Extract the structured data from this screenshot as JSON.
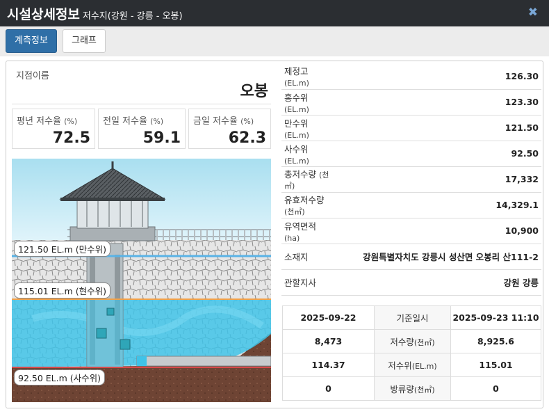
{
  "header": {
    "title": "시설상세정보",
    "subtitle": "저수지(강원 - 강릉 - 오봉)",
    "close_icon": "close-icon"
  },
  "tabs": [
    {
      "label": "계측정보",
      "active": true
    },
    {
      "label": "그래프",
      "active": false
    }
  ],
  "site": {
    "name_label": "지점이름",
    "name": "오봉"
  },
  "rates": [
    {
      "label": "평년 저수율",
      "unit": "(%)",
      "value": "72.5"
    },
    {
      "label": "전일 저수율",
      "unit": "(%)",
      "value": "59.1"
    },
    {
      "label": "금일 저수율",
      "unit": "(%)",
      "value": "62.3"
    }
  ],
  "levels": {
    "full": "121.50 EL.m (만수위)",
    "current": "115.01 EL.m (현수위)",
    "dead": "92.50 EL.m (사수위)"
  },
  "info": [
    {
      "key": "제정고",
      "unit": "(EL.m)",
      "value": "126.30"
    },
    {
      "key": "홍수위",
      "unit": "(EL.m)",
      "value": "123.30"
    },
    {
      "key": "만수위",
      "unit": "(EL.m)",
      "value": "121.50"
    },
    {
      "key": "사수위",
      "unit": "(EL.m)",
      "value": "92.50"
    },
    {
      "key": "총저수량",
      "unit": "(천㎥)",
      "value": "17,332"
    },
    {
      "key": "유효저수량",
      "unit": "(천㎥)",
      "value": "14,329.1"
    },
    {
      "key": "유역면적",
      "unit": "(ha)",
      "value": "10,900"
    },
    {
      "key": "소재지",
      "unit": "",
      "value": "강원특별자치도 강릉시 성산면 오봉리 산111-2"
    },
    {
      "key": "관할지사",
      "unit": "",
      "value": "강원 강릉"
    }
  ],
  "observation": {
    "prev_date": "2025-09-22",
    "base_label": "기준일시",
    "curr_date": "2025-09-23 11:10",
    "rows": [
      {
        "prev": "8,473",
        "label": "저수량",
        "unit": "(천㎥)",
        "curr": "8,925.6"
      },
      {
        "prev": "114.37",
        "label": "저수위",
        "unit": "(EL.m)",
        "curr": "115.01"
      },
      {
        "prev": "0",
        "label": "방류량",
        "unit": "(천㎥)",
        "curr": "0"
      }
    ]
  },
  "colors": {
    "header_bg": "#2b2e32",
    "tab_active": "#2f6fa7",
    "water": "#3fc3e8",
    "sky": "#c9ecf6"
  }
}
